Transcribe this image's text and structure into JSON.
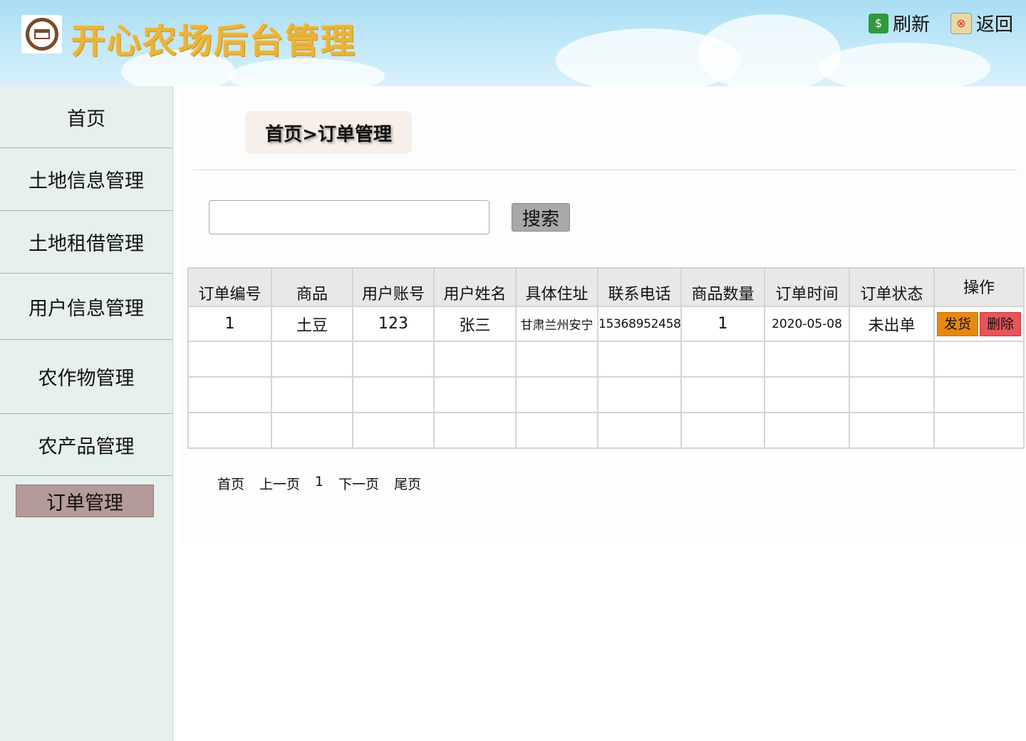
{
  "header": {
    "title": "开心农场后台管理",
    "refresh_label": "刷新",
    "back_label": "返回"
  },
  "sidebar": {
    "items": [
      {
        "label": "首页"
      },
      {
        "label": "土地信息管理"
      },
      {
        "label": "土地租借管理"
      },
      {
        "label": "用户信息管理"
      },
      {
        "label": "农作物管理"
      },
      {
        "label": "农产品管理"
      },
      {
        "label": "订单管理",
        "active": true
      }
    ]
  },
  "breadcrumb": "首页>订单管理",
  "search": {
    "value": "",
    "placeholder": "",
    "button_label": "搜索"
  },
  "table": {
    "columns": [
      "订单编号",
      "商品",
      "用户账号",
      "用户姓名",
      "具体住址",
      "联系电话",
      "商品数量",
      "订单时间",
      "订单状态",
      "操作"
    ],
    "rows": [
      {
        "order_id": "1",
        "product": "土豆",
        "account": "123",
        "name": "张三",
        "address": "甘肃兰州安宁",
        "phone": "15368952458",
        "quantity": "1",
        "time": "2020-05-08",
        "status": "未出单",
        "ship_label": "发货",
        "delete_label": "删除"
      }
    ]
  },
  "pager": {
    "first": "首页",
    "prev": "上一页",
    "current": "1",
    "next": "下一页",
    "last": "尾页"
  },
  "colors": {
    "sidebar_bg": "#e6f0ec",
    "active_nav": "#b49a98",
    "ship_button": "#e8890f",
    "delete_button": "#e8545a",
    "title_color": "#e8b53b"
  }
}
